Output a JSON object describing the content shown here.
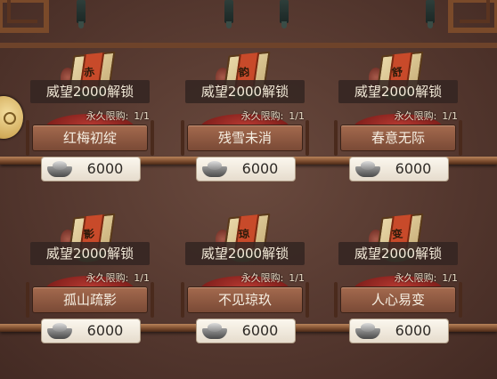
{
  "shop_items": [
    {
      "unlock": "威望2000解锁",
      "limit_label": "永久限购:",
      "limit_value": "1/1",
      "name": "红梅初绽",
      "price": "6000",
      "book_char": "赤"
    },
    {
      "unlock": "威望2000解锁",
      "limit_label": "永久限购:",
      "limit_value": "1/1",
      "name": "残雪未消",
      "price": "6000",
      "book_char": "韵"
    },
    {
      "unlock": "威望2000解锁",
      "limit_label": "永久限购:",
      "limit_value": "1/1",
      "name": "春意无际",
      "price": "6000",
      "book_char": "舒"
    },
    {
      "unlock": "威望2000解锁",
      "limit_label": "永久限购:",
      "limit_value": "1/1",
      "name": "孤山疏影",
      "price": "6000",
      "book_char": "影"
    },
    {
      "unlock": "威望2000解锁",
      "limit_label": "永久限购:",
      "limit_value": "1/1",
      "name": "不见琼玖",
      "price": "6000",
      "book_char": "琼"
    },
    {
      "unlock": "威望2000解锁",
      "limit_label": "永久限购:",
      "limit_value": "1/1",
      "name": "人心易变",
      "price": "6000",
      "book_char": "变"
    }
  ],
  "icons": {
    "currency": "silver-ingot-icon",
    "side_button": "gold-coin-icon"
  },
  "colors": {
    "name_bar": "#8c5840",
    "price_pill": "#f4efe4",
    "unlock_bg": "#342622",
    "cushion": "#a3302a"
  }
}
